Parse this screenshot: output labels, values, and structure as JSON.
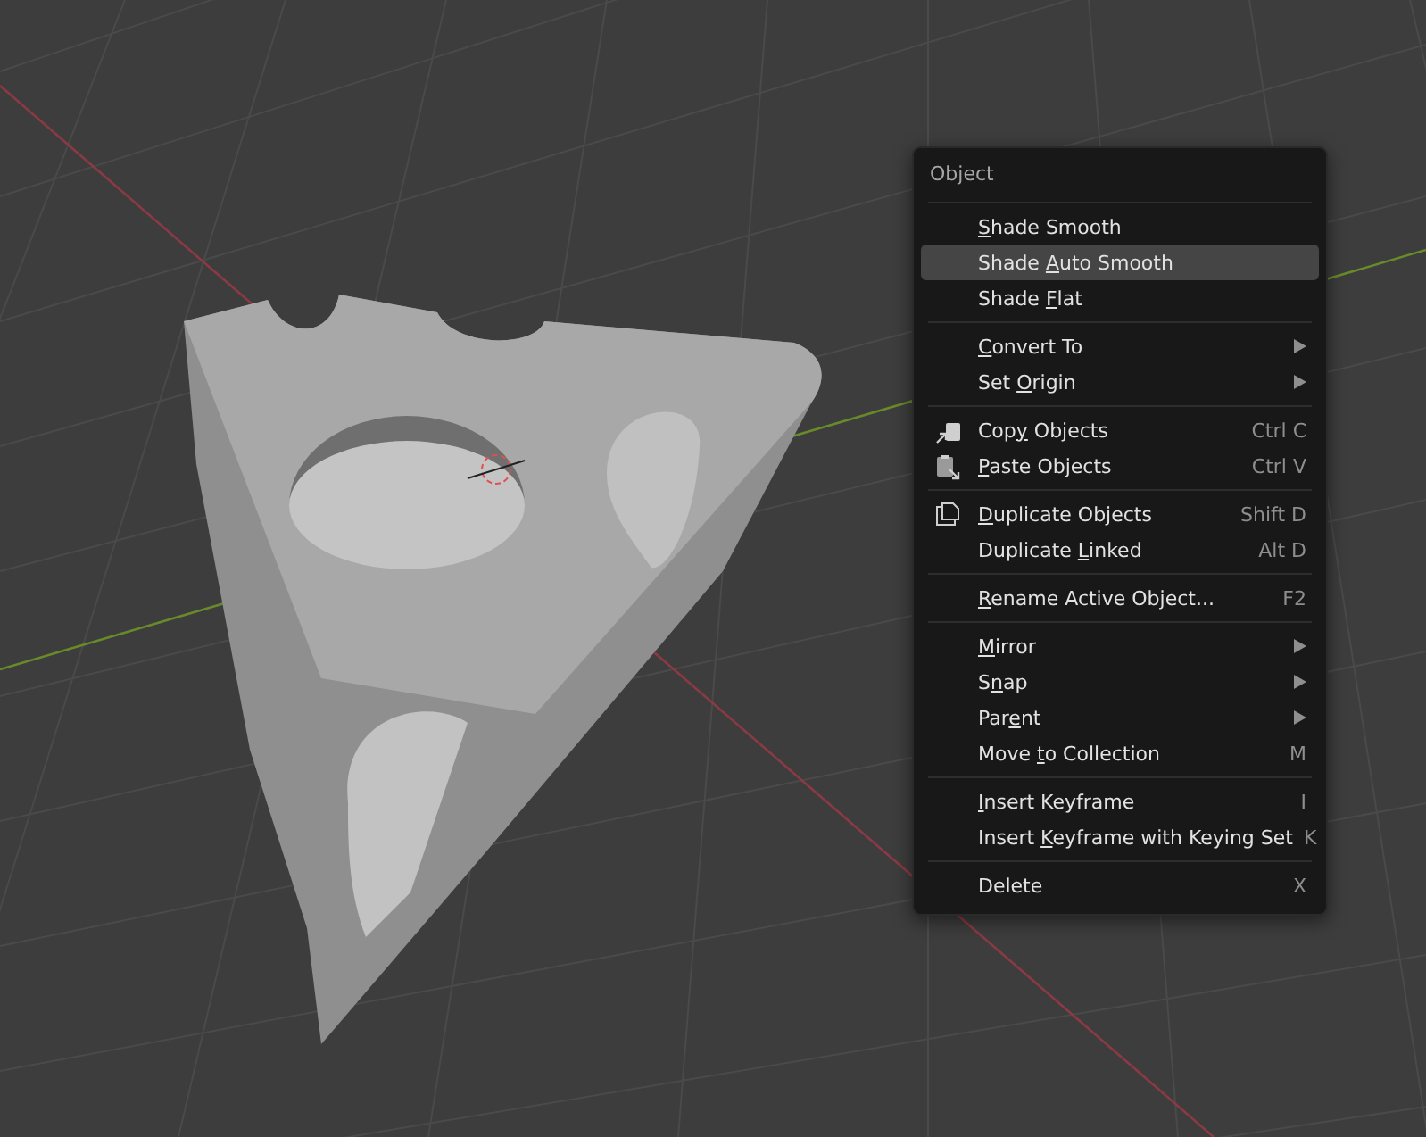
{
  "menu": {
    "title": "Object",
    "sections": [
      [
        {
          "kind": "plain",
          "key": "S",
          "post": "hade Smooth",
          "selected": false
        },
        {
          "kind": "plain",
          "pre": "Shade ",
          "key": "A",
          "post": "uto Smooth",
          "selected": true
        },
        {
          "kind": "plain",
          "pre": "Shade ",
          "key": "F",
          "post": "lat",
          "selected": false
        }
      ],
      [
        {
          "kind": "plain",
          "key": "C",
          "post": "onvert To",
          "submenu": true,
          "selected": false
        },
        {
          "kind": "plain",
          "pre": "Set ",
          "key": "O",
          "post": "rigin",
          "submenu": true,
          "selected": false
        }
      ],
      [
        {
          "kind": "copy",
          "pre": "Cop",
          "key": "y",
          "post": " Objects",
          "shortcut": "Ctrl C",
          "selected": false
        },
        {
          "kind": "paste",
          "key": "P",
          "post": "aste Objects",
          "shortcut": "Ctrl V",
          "selected": false
        }
      ],
      [
        {
          "kind": "duplicate",
          "key": "D",
          "post": "uplicate Objects",
          "shortcut": "Shift D",
          "selected": false
        },
        {
          "kind": "plain",
          "pre": "Duplicate ",
          "key": "L",
          "post": "inked",
          "shortcut": "Alt D",
          "selected": false
        }
      ],
      [
        {
          "kind": "plain",
          "key": "R",
          "post": "ename Active Object...",
          "shortcut": "F2",
          "selected": false
        }
      ],
      [
        {
          "kind": "plain",
          "key": "M",
          "post": "irror",
          "submenu": true,
          "selected": false
        },
        {
          "kind": "plain",
          "pre": "S",
          "key": "n",
          "post": "ap",
          "submenu": true,
          "selected": false
        },
        {
          "kind": "plain",
          "pre": "Par",
          "key": "e",
          "post": "nt",
          "submenu": true,
          "selected": false
        },
        {
          "kind": "plain",
          "pre": "Move ",
          "key": "t",
          "post": "o Collection",
          "shortcut": "M",
          "selected": false
        }
      ],
      [
        {
          "kind": "plain",
          "key": "I",
          "post": "nsert Keyframe",
          "shortcut": "I",
          "selected": false
        },
        {
          "kind": "plain",
          "pre": "Insert ",
          "key": "K",
          "post": "eyframe with Keying Set",
          "shortcut": "K",
          "selected": false
        }
      ],
      [
        {
          "kind": "plain",
          "pre": "Delete",
          "shortcut": "X",
          "selected": false
        }
      ]
    ]
  }
}
